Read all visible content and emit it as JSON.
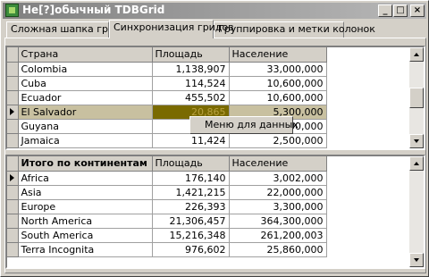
{
  "window": {
    "title": "He[?]обычный TDBGrid",
    "min_glyph": "_",
    "max_glyph": "□",
    "close_glyph": "×"
  },
  "tabs": [
    {
      "label": "Сложная шапка грида"
    },
    {
      "label": "Синхронизация гридов"
    },
    {
      "label": "Группировка и метки колонок"
    }
  ],
  "top_grid": {
    "columns": [
      "Страна",
      "Площадь",
      "Население"
    ],
    "rows": [
      {
        "country": "Colombia",
        "area": "1,138,907",
        "population": "33,000,000"
      },
      {
        "country": "Cuba",
        "area": "114,524",
        "population": "10,600,000"
      },
      {
        "country": "Ecuador",
        "area": "455,502",
        "population": "10,600,000"
      },
      {
        "country": "El Salvador",
        "area": "20,865",
        "population": "5,300,000"
      },
      {
        "country": "Guyana",
        "area": "",
        "population": "800,000"
      },
      {
        "country": "Jamaica",
        "area": "11,424",
        "population": "2,500,000"
      }
    ],
    "selected_index": 3
  },
  "bottom_grid": {
    "columns": [
      "Итого по континентам",
      "Площадь",
      "Население"
    ],
    "rows": [
      {
        "continent": "Africa",
        "area": "176,140",
        "population": "3,002,000"
      },
      {
        "continent": "Asia",
        "area": "1,421,215",
        "population": "22,000,000"
      },
      {
        "continent": "Europe",
        "area": "226,393",
        "population": "3,300,000"
      },
      {
        "continent": "North America",
        "area": "21,306,457",
        "population": "364,300,000"
      },
      {
        "continent": "South America",
        "area": "15,216,348",
        "population": "261,200,003"
      },
      {
        "continent": "Terra Incognita",
        "area": "976,602",
        "population": "25,860,000"
      }
    ],
    "current_index": 0
  },
  "popup": {
    "label": "Меню для данных"
  }
}
